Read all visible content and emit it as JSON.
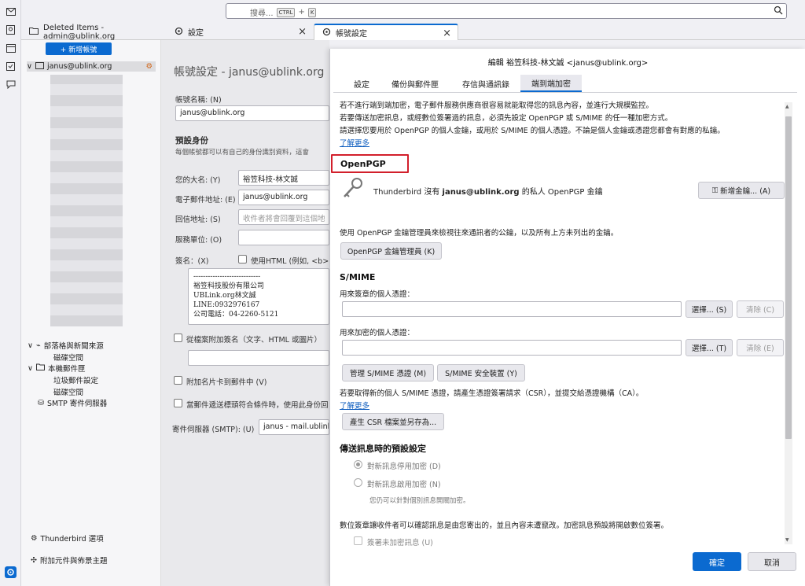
{
  "colors": {
    "accent": "#0b6ad0",
    "highlight_box": "#d21f2b"
  },
  "search": {
    "placeholder": "搜尋...",
    "kbd1": "CTRL",
    "plus": "+",
    "kbd2": "K"
  },
  "tabs": [
    {
      "label": "Deleted Items - admin@ublink.org",
      "icon": "folder-icon"
    },
    {
      "label": "設定",
      "icon": "gear-icon"
    },
    {
      "label": "帳號設定",
      "icon": "account-settings-icon"
    }
  ],
  "folders": {
    "new_message": "+ 新增帳號",
    "account": "janus@ublink.org",
    "items": [
      "部落格與新聞來源",
      "磁碟空間",
      "本機郵件匣",
      "垃圾郵件設定",
      "磁碟空間",
      "SMTP 寄件伺服器"
    ],
    "bottom": [
      "Thunderbird 選項",
      "附加元件與佈景主題"
    ]
  },
  "account_pane": {
    "title": "帳號設定 - janus@ublink.org",
    "account_name_label": "帳號名稱: (N)",
    "account_name_value": "janus@ublink.org",
    "default_identity": "預設身份",
    "identity_desc": "每個帳號都可以有自己的身份識別資料，這會",
    "your_name_label": "您的大名: (Y)",
    "your_name_value": "裕笠科技-林文誠",
    "email_label": "電子郵件地址: (E)",
    "email_value": "janus@ublink.org",
    "reply_label": "回信地址: (S)",
    "reply_placeholder": "收件者將會回覆到這個地",
    "org_label": "服務單位: (O)",
    "sig_label": "簽名：(X)",
    "html_label": "使用HTML (例如, <b>",
    "sig_lines": [
      "----------------------------",
      "裕笠科技股份有限公司",
      "UBLink.org林文誠",
      "LINE:0932976167",
      "公司電話：04-2260-5121"
    ],
    "attach_sig": "從檔案附加簽名（文字、HTML 或圖片）",
    "attach_card": "附加名片卡到郵件中 (V)",
    "redirect_label": "當郵件遞送標頭符合條件時，使用此身份回",
    "smtp_label": "寄件伺服器 (SMTP): (U)",
    "smtp_value": "janus - mail.ublink"
  },
  "dialog": {
    "title": "編輯 裕笠科技-林文誠 <janus@ublink.org>",
    "tabs": [
      "設定",
      "備份與郵件匣",
      "存信與通訊錄",
      "端到端加密"
    ],
    "intro": [
      "若不進行端到端加密，電子郵件服務供應商很容易就能取得您的訊息內容，並進行大規模監控。",
      "若要傳送加密訊息，或經數位簽署過的訊息，必須先設定 OpenPGP 或 S/MIME 的任一種加密方式。",
      "請選擇您要用於 OpenPGP 的個人金鑰，或用於 S/MIME 的個人憑證。不論是個人金鑰或憑證您都會有對應的私鑰。"
    ],
    "learn_more": "了解更多",
    "openpgp_heading": "OpenPGP",
    "no_key_prefix": "Thunderbird 沒有",
    "no_key_account": "janus@ublink.org",
    "no_key_suffix": "的私人 OpenPGP 金鑰",
    "add_key": "新增金鑰... (A)",
    "key_manager_desc": "使用 OpenPGP 金鑰管理員來檢視往來通訊者的公鑰，以及所有上方未列出的金鑰。",
    "key_manager_btn": "OpenPGP 金鑰管理員 (K)",
    "smime_heading": "S/MIME",
    "sign_cert_label": "用來簽章的個人憑證：",
    "select_s": "選擇... (S)",
    "clear_c": "清除 (C)",
    "encrypt_cert_label": "用來加密的個人憑證：",
    "select_t": "選擇... (T)",
    "clear_e": "清除 (E)",
    "manage_certs": "管理 S/MIME 憑證 (M)",
    "security_devices": "S/MIME 安全裝置 (Y)",
    "csr_desc": "若要取得新的個人 S/MIME 憑證，請產生憑證簽署請求（CSR），並提交給憑證機構（CA）。",
    "learn_more2": "了解更多",
    "csr_btn": "產生 CSR 檔案並另存為...",
    "defaults_heading": "傳送訊息時的預設設定",
    "radio_off": "對新訊息停用加密 (D)",
    "radio_on": "對新訊息啟用加密 (N)",
    "radio_hint": "您仍可以針對個別訊息開關加密。",
    "sign_desc": "數位簽章讓收件者可以確認訊息是由您寄出的，並且內容未遭竄改。加密訊息預設將開啟數位簽署。",
    "sign_unencrypted": "簽署未加密訊息 (U)",
    "ok": "確定",
    "cancel": "取消"
  }
}
